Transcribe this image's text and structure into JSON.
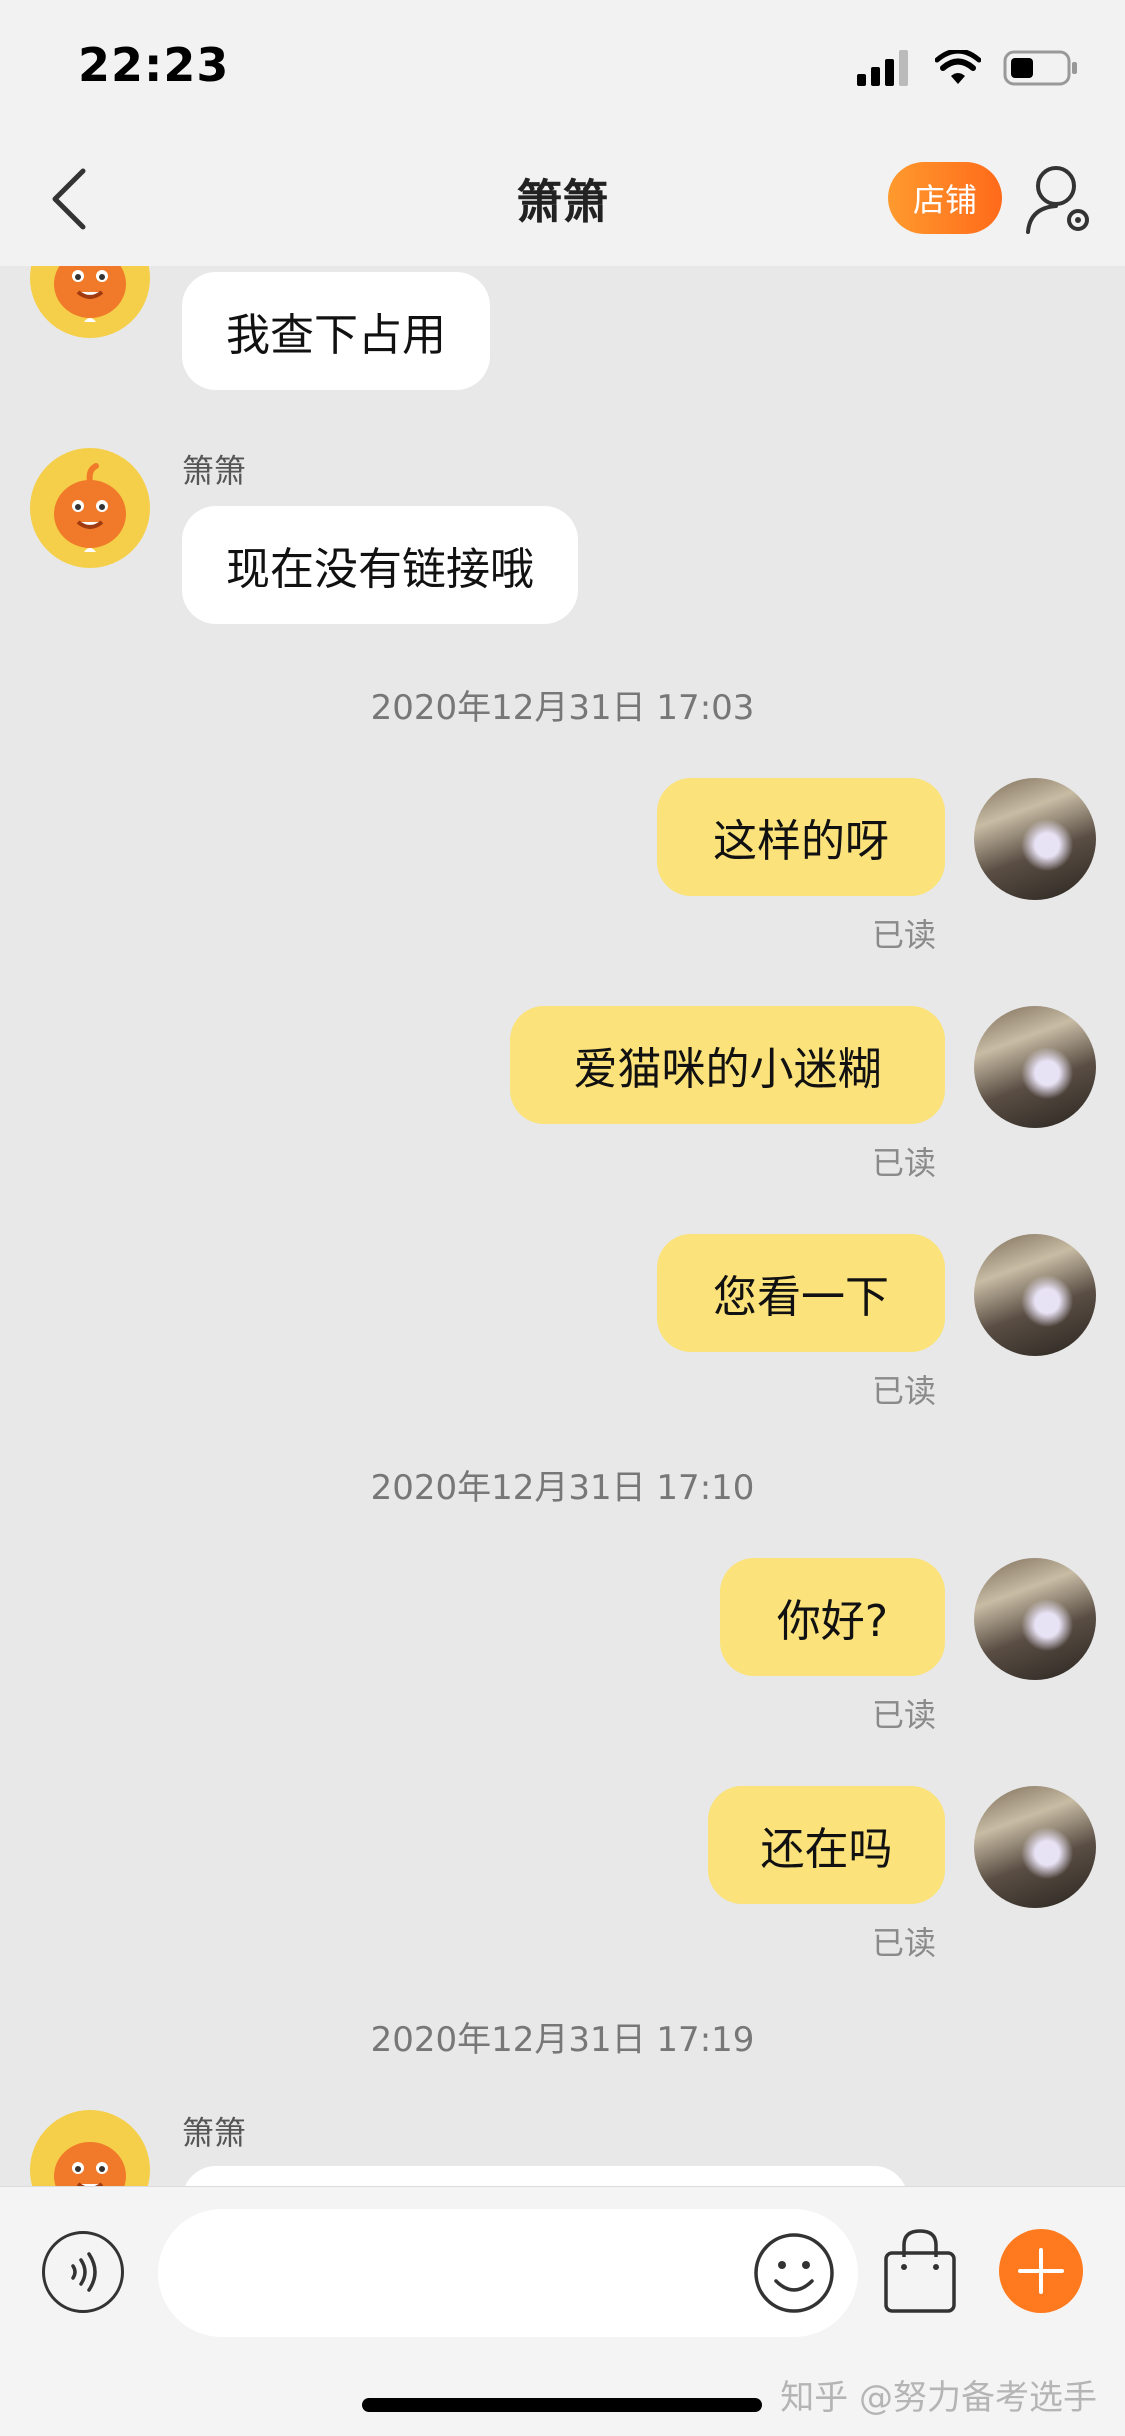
{
  "status_bar": {
    "time": "22:23"
  },
  "nav": {
    "title": "箫箫",
    "shop_label": "店铺"
  },
  "messages": {
    "m1": {
      "text": "我查下占用"
    },
    "m2": {
      "sender": "箫箫",
      "text": "现在没有链接哦"
    },
    "ts1": "2020年12月31日 17:03",
    "m3": {
      "text": "这样的呀",
      "status": "已读"
    },
    "m4": {
      "text": "爱猫咪的小迷糊",
      "status": "已读"
    },
    "m5": {
      "text": "您看一下",
      "status": "已读"
    },
    "ts2": "2020年12月31日 17:10",
    "m6": {
      "text": "你好?",
      "status": "已读"
    },
    "m7": {
      "text": "还在吗",
      "status": "已读"
    },
    "ts3": "2020年12月31日 17:19",
    "m8": {
      "sender": "箫箫"
    }
  },
  "input": {
    "placeholder": ""
  },
  "watermark": "知乎 @努力备考选手",
  "colors": {
    "accent": "#ff7a1e",
    "bubble_out": "#fbe27a",
    "bubble_in": "#ffffff",
    "background": "#e8e8e8"
  }
}
